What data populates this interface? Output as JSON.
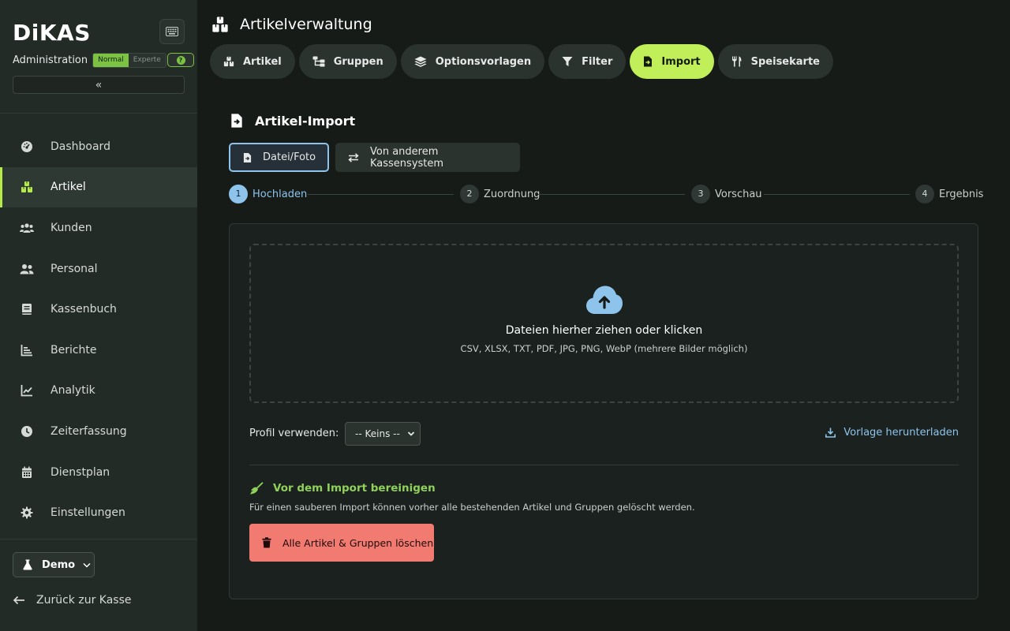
{
  "app": {
    "logo": "DiKAS",
    "admin_label": "Administration",
    "mode_normal": "Normal",
    "mode_expert": "Experte",
    "help": "?",
    "collapse_glyph": "«"
  },
  "sidebar": {
    "items": [
      {
        "label": "Dashboard",
        "icon": "dashboard-icon"
      },
      {
        "label": "Artikel",
        "icon": "artikel-icon",
        "active": true
      },
      {
        "label": "Kunden",
        "icon": "users-icon"
      },
      {
        "label": "Personal",
        "icon": "personal-icon"
      },
      {
        "label": "Kassenbuch",
        "icon": "book-icon"
      },
      {
        "label": "Berichte",
        "icon": "bar-chart-icon"
      },
      {
        "label": "Analytik",
        "icon": "line-chart-icon"
      },
      {
        "label": "Zeiterfassung",
        "icon": "clock-icon"
      },
      {
        "label": "Dienstplan",
        "icon": "calendar-icon"
      },
      {
        "label": "Einstellungen",
        "icon": "gear-icon"
      }
    ],
    "demo_label": "Demo",
    "back_label": "Zurück zur Kasse"
  },
  "header": {
    "title": "Artikelverwaltung"
  },
  "tabs": [
    {
      "label": "Artikel",
      "icon": "artikel-icon"
    },
    {
      "label": "Gruppen",
      "icon": "tree-icon"
    },
    {
      "label": "Optionsvorlagen",
      "icon": "layers-icon"
    },
    {
      "label": "Filter",
      "icon": "filter-icon"
    },
    {
      "label": "Import",
      "icon": "file-import-icon",
      "active": true
    },
    {
      "label": "Speisekarte",
      "icon": "utensils-icon"
    }
  ],
  "main": {
    "section_title": "Artikel-Import",
    "source_file": "Datei/Foto",
    "source_other": "Von anderem Kassensystem",
    "steps": [
      {
        "num": "1",
        "label": "Hochladen"
      },
      {
        "num": "2",
        "label": "Zuordnung"
      },
      {
        "num": "3",
        "label": "Vorschau"
      },
      {
        "num": "4",
        "label": "Ergebnis"
      }
    ],
    "dropzone_title": "Dateien hierher ziehen oder klicken",
    "dropzone_sub": "CSV, XLSX, TXT, PDF, JPG, PNG, WebP (mehrere Bilder möglich)",
    "profile_label": "Profil verwenden:",
    "profile_value": "-- Keins --",
    "template_link": "Vorlage herunterladen",
    "clean_title": "Vor dem Import bereinigen",
    "clean_desc": "Für einen sauberen Import können vorher alle bestehenden Artikel und Gruppen gelöscht werden.",
    "delete_button": "Alle Artikel & Gruppen löschen"
  },
  "colors": {
    "accent": "#c1ef59",
    "active_blue": "#8ec3ec",
    "danger": "#f27b71",
    "success": "#8fd15a"
  }
}
